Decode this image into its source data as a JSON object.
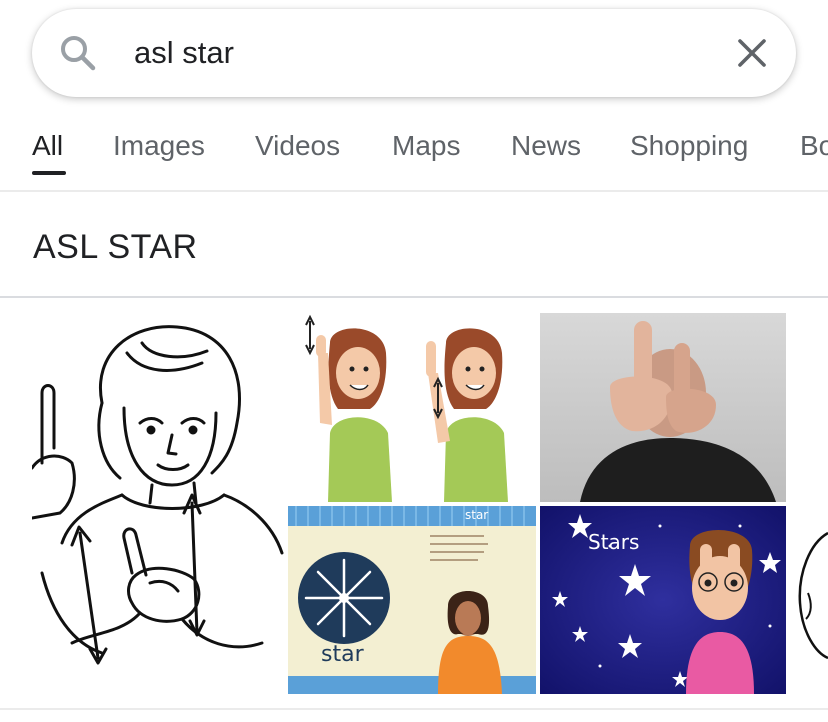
{
  "search": {
    "query": "asl star",
    "search_icon": "search-icon",
    "clear_icon": "close-icon"
  },
  "tabs": [
    {
      "label": "All",
      "active": true
    },
    {
      "label": "Images",
      "active": false
    },
    {
      "label": "Videos",
      "active": false
    },
    {
      "label": "Maps",
      "active": false
    },
    {
      "label": "News",
      "active": false
    },
    {
      "label": "Shopping",
      "active": false
    },
    {
      "label": "Bo",
      "active": false
    }
  ],
  "results": {
    "title": "ASL STAR",
    "images": [
      {
        "id": "sketch-person-sign",
        "caption": ""
      },
      {
        "id": "cartoon-woman-sign",
        "caption": ""
      },
      {
        "id": "man-signing-photo",
        "caption": ""
      },
      {
        "id": "star-flashcard",
        "caption": "star",
        "header_text": "star",
        "word": "star"
      },
      {
        "id": "stars-cartoon-girl",
        "caption": "Stars"
      },
      {
        "id": "partial-sketch",
        "caption": ""
      }
    ]
  },
  "colors": {
    "accent_text": "#202124",
    "muted_text": "#5f6368",
    "divider": "#dadce0"
  }
}
